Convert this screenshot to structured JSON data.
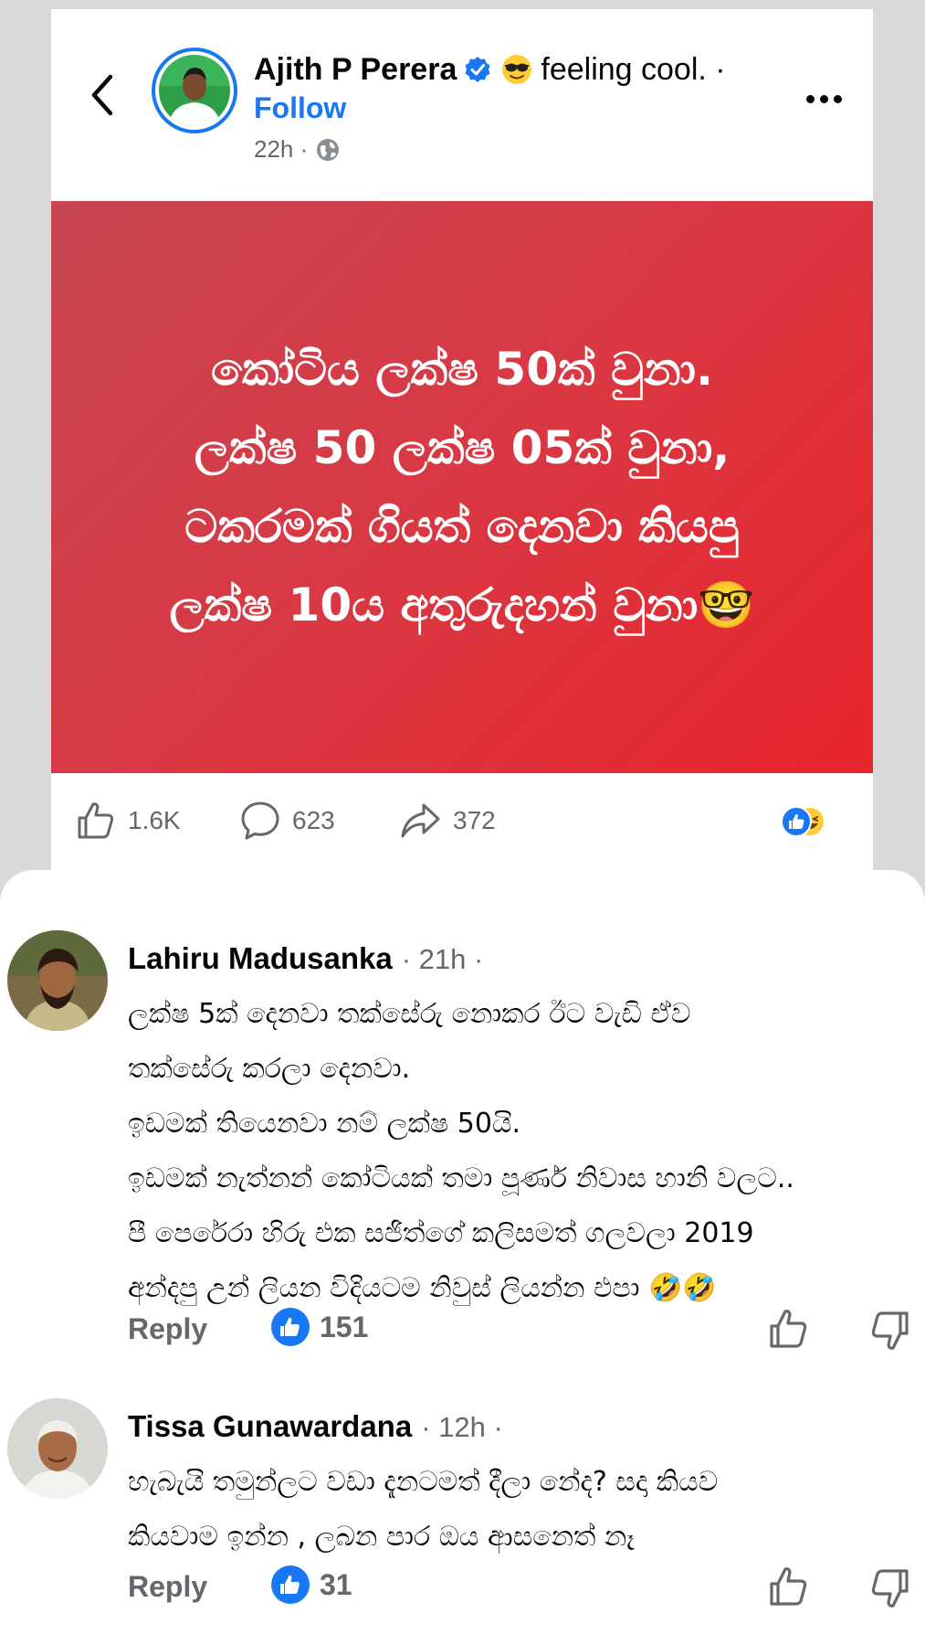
{
  "post": {
    "author": "Ajith P Perera",
    "feeling_text": "feeling cool. ·",
    "follow_label": "Follow",
    "time": "22h ·",
    "image_lines": [
      "කෝටිය ලක්ෂ 50ක් වුනා.",
      "ලක්ෂ 50 ලක්ෂ 05ක් වුනා,",
      "ටකරමක් ගියත් දෙනවා කියපු",
      "ලක්ෂ 10ය අතුරුදහන් වුනා🤓"
    ],
    "likes": "1.6K",
    "comments": "623",
    "shares": "372"
  },
  "comments": [
    {
      "name": "Lahiru Madusanka",
      "time": "· 21h ·",
      "lines": [
        "ලක්ෂ 5ක් දෙනවා තක්සේරු නොකර ඊට වැඩි ඒව",
        "තක්සේරු කරලා දෙනවා.",
        "ඉඩමක් තියෙනවා නම් ලක්ෂ 50යි.",
        "ඉඩමක් නැත්නන් කෝටියක් තමා පූර්ණ නිවාස හානි වලට..",
        "පී පෙරේරා හිරු එක සජිත්ගේ කලිසමත් ගලවලා 2019",
        "අන්දපු උන් ලියන විදියටම නිවුස් ලියන්න එපා 🤣🤣"
      ],
      "reply_label": "Reply",
      "likes": "151"
    },
    {
      "name": "Tissa Gunawardana",
      "time": "· 12h ·",
      "lines": [
        "හැබැයි තමුන්ලට වඩා දැනටමත් දීලා නේද? සදා කියව",
        "කියවාම ඉන්න , ලබන පාර ඔය ආසනෙත් නෑ"
      ],
      "reply_label": "Reply",
      "likes": "31"
    }
  ],
  "colors": {
    "accent": "#1877f2",
    "post_bg_start": "#c64651",
    "post_bg_end": "#e8252c",
    "muted": "#65676b"
  },
  "icons": [
    "back-arrow-icon",
    "verified-badge-icon",
    "sunglasses-emoji-icon",
    "globe-icon",
    "more-dots-icon",
    "like-icon",
    "comment-icon",
    "share-icon",
    "like-reaction-icon",
    "haha-reaction-icon",
    "thumbs-up-filled-icon",
    "thumbs-down-icon"
  ]
}
